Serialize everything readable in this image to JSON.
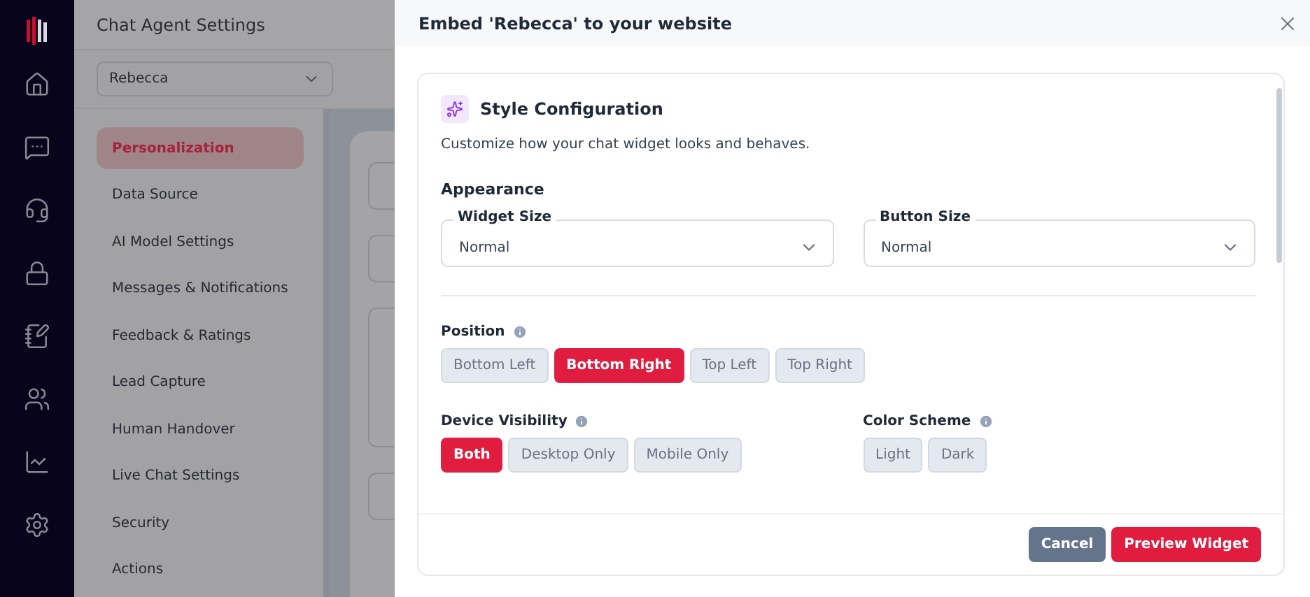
{
  "page": {
    "title": "Chat Agent Settings",
    "agent_select": {
      "value": "Rebecca"
    },
    "menu": [
      {
        "label": "Personalization",
        "selected": true
      },
      {
        "label": "Data Source",
        "selected": false
      },
      {
        "label": "AI Model Settings",
        "selected": false
      },
      {
        "label": "Messages & Notifications",
        "selected": false
      },
      {
        "label": "Feedback & Ratings",
        "selected": false
      },
      {
        "label": "Lead Capture",
        "selected": false
      },
      {
        "label": "Human Handover",
        "selected": false
      },
      {
        "label": "Live Chat Settings",
        "selected": false
      },
      {
        "label": "Security",
        "selected": false
      },
      {
        "label": "Actions",
        "selected": false
      }
    ]
  },
  "dialog": {
    "title": "Embed 'Rebecca' to your website",
    "section": {
      "title": "Style Configuration",
      "description": "Customize how your chat widget looks and behaves.",
      "appearance": {
        "heading": "Appearance",
        "fields": [
          {
            "label": "Widget Size",
            "value": "Normal"
          },
          {
            "label": "Button Size",
            "value": "Normal"
          }
        ]
      },
      "groups": [
        {
          "label": "Position",
          "options": [
            {
              "label": "Bottom Left",
              "selected": false
            },
            {
              "label": "Bottom Right",
              "selected": true
            },
            {
              "label": "Top Left",
              "selected": false
            },
            {
              "label": "Top Right",
              "selected": false
            }
          ]
        },
        {
          "label": "Device Visibility",
          "options": [
            {
              "label": "Both",
              "selected": true
            },
            {
              "label": "Desktop Only",
              "selected": false
            },
            {
              "label": "Mobile Only",
              "selected": false
            }
          ]
        },
        {
          "label": "Color Scheme",
          "options": [
            {
              "label": "Light",
              "selected": false
            },
            {
              "label": "Dark",
              "selected": false
            }
          ]
        }
      ]
    },
    "buttons": [
      {
        "label": "Cancel",
        "kind": "secondary"
      },
      {
        "label": "Preview Widget",
        "kind": "primary"
      }
    ]
  }
}
